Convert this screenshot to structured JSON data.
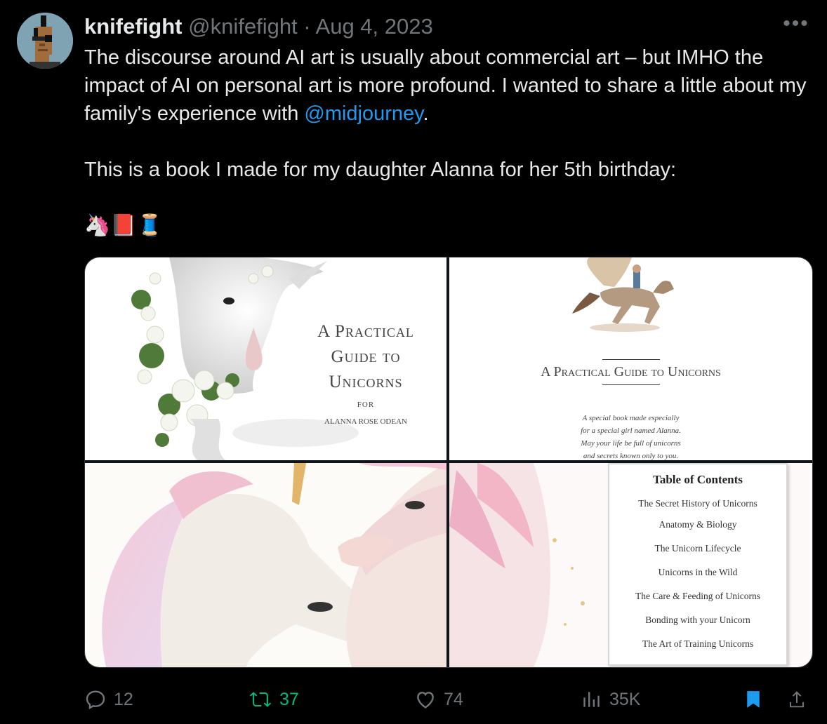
{
  "author": {
    "display_name": "knifefight",
    "handle": "@knifefight",
    "separator": "·",
    "date": "Aug 4, 2023"
  },
  "more_label": "•••",
  "tweet": {
    "paragraph1_before": "The discourse around AI art is usually about commercial art – but IMHO the impact of AI on personal art is more profound. I wanted to share a little about my family's experience with ",
    "mention": "@midjourney",
    "paragraph1_after": ".",
    "paragraph2": "This is a book I made for my daughter Alanna for her 5th birthday:",
    "emojis": "🦄📕🧵"
  },
  "images": {
    "cover": {
      "title_line1": "A Practical",
      "title_line2": "Guide to",
      "title_line3": "Unicorns",
      "for_label": "FOR",
      "recipient": "ALANNA ROSE ODEAN"
    },
    "title_page": {
      "title": "A Practical Guide to Unicorns",
      "dedication_line1": "A special book made especially",
      "dedication_line2": "for a special girl named Alanna.",
      "dedication_line3": "May your life be full of unicorns",
      "dedication_line4": "and secrets known only to you."
    },
    "toc": {
      "title": "Table of Contents",
      "items": [
        "The Secret History of Unicorns",
        "Anatomy & Biology",
        "The Unicorn Lifecycle",
        "Unicorns in the Wild",
        "The Care & Feeding of Unicorns",
        "Bonding with your Unicorn",
        "The Art of Training Unicorns"
      ]
    }
  },
  "actions": {
    "replies": "12",
    "retweets": "37",
    "likes": "74",
    "views": "35K"
  },
  "colors": {
    "accent": "#1d9bf0",
    "retweet": "#00ba7c",
    "muted": "#71767b"
  }
}
